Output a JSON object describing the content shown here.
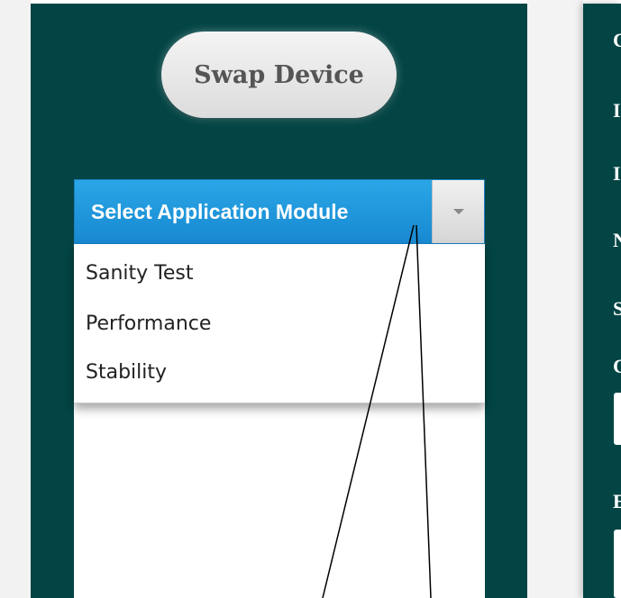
{
  "left_panel": {
    "swap_button_label": "Swap Device",
    "select": {
      "selected_label": "Select Application Module",
      "options": [
        "Sanity Test",
        "Performance",
        "Stability"
      ]
    }
  },
  "right_panel": {
    "labels": [
      "C",
      "I",
      "I",
      "N",
      "S",
      "C",
      "E"
    ]
  },
  "colors": {
    "panel_bg": "#034444",
    "select_bg": "#1d8fd6",
    "button_bg": "#e8e8e8"
  }
}
